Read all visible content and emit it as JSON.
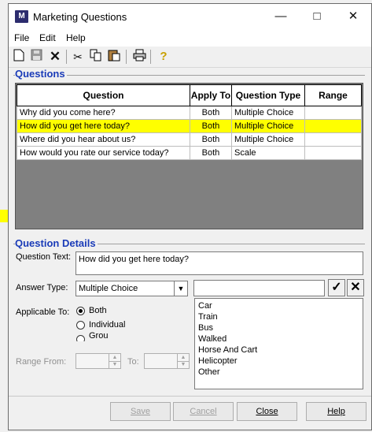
{
  "window": {
    "title": "Marketing Questions",
    "app_icon_text": "M"
  },
  "menu": [
    "File",
    "Edit",
    "Help"
  ],
  "toolbar": {
    "icons": [
      "new-icon",
      "save-icon",
      "delete-icon",
      "cut-icon",
      "copy-icon",
      "paste-icon",
      "print-icon",
      "help-icon"
    ]
  },
  "questions_section": {
    "title": "Questions",
    "columns": [
      "Question",
      "Apply To",
      "Question Type",
      "Range"
    ],
    "rows": [
      {
        "question": "Why did you come here?",
        "apply_to": "Both",
        "type": "Multiple Choice",
        "range": ""
      },
      {
        "question": "How did you get here today?",
        "apply_to": "Both",
        "type": "Multiple Choice",
        "range": ""
      },
      {
        "question": "Where did you hear about us?",
        "apply_to": "Both",
        "type": "Multiple Choice",
        "range": ""
      },
      {
        "question": "How would you rate our service today?",
        "apply_to": "Both",
        "type": "Scale",
        "range": ""
      }
    ],
    "selected_row": 1,
    "selection_color": "#ffff00"
  },
  "details": {
    "title": "Question Details",
    "question_text_label": "Question Text:",
    "question_text_value": "How did you get here today?",
    "answer_type_label": "Answer Type:",
    "answer_type_value": "Multiple Choice",
    "answer_input_value": "",
    "applicable_label": "Applicable To:",
    "applicable_options": [
      "Both",
      "Individual",
      "Grou"
    ],
    "applicable_selected": "Both",
    "range_from_label": "Range From:",
    "range_to_label": "To:",
    "answers": [
      "Car",
      "Train",
      "Bus",
      "Walked",
      "Horse And Cart",
      "Helicopter",
      "Other"
    ]
  },
  "buttons": {
    "save": "Save",
    "cancel": "Cancel",
    "close": "Close",
    "help": "Help"
  },
  "colors": {
    "section_title": "#1a3bb8",
    "highlight": "#ffff00"
  }
}
